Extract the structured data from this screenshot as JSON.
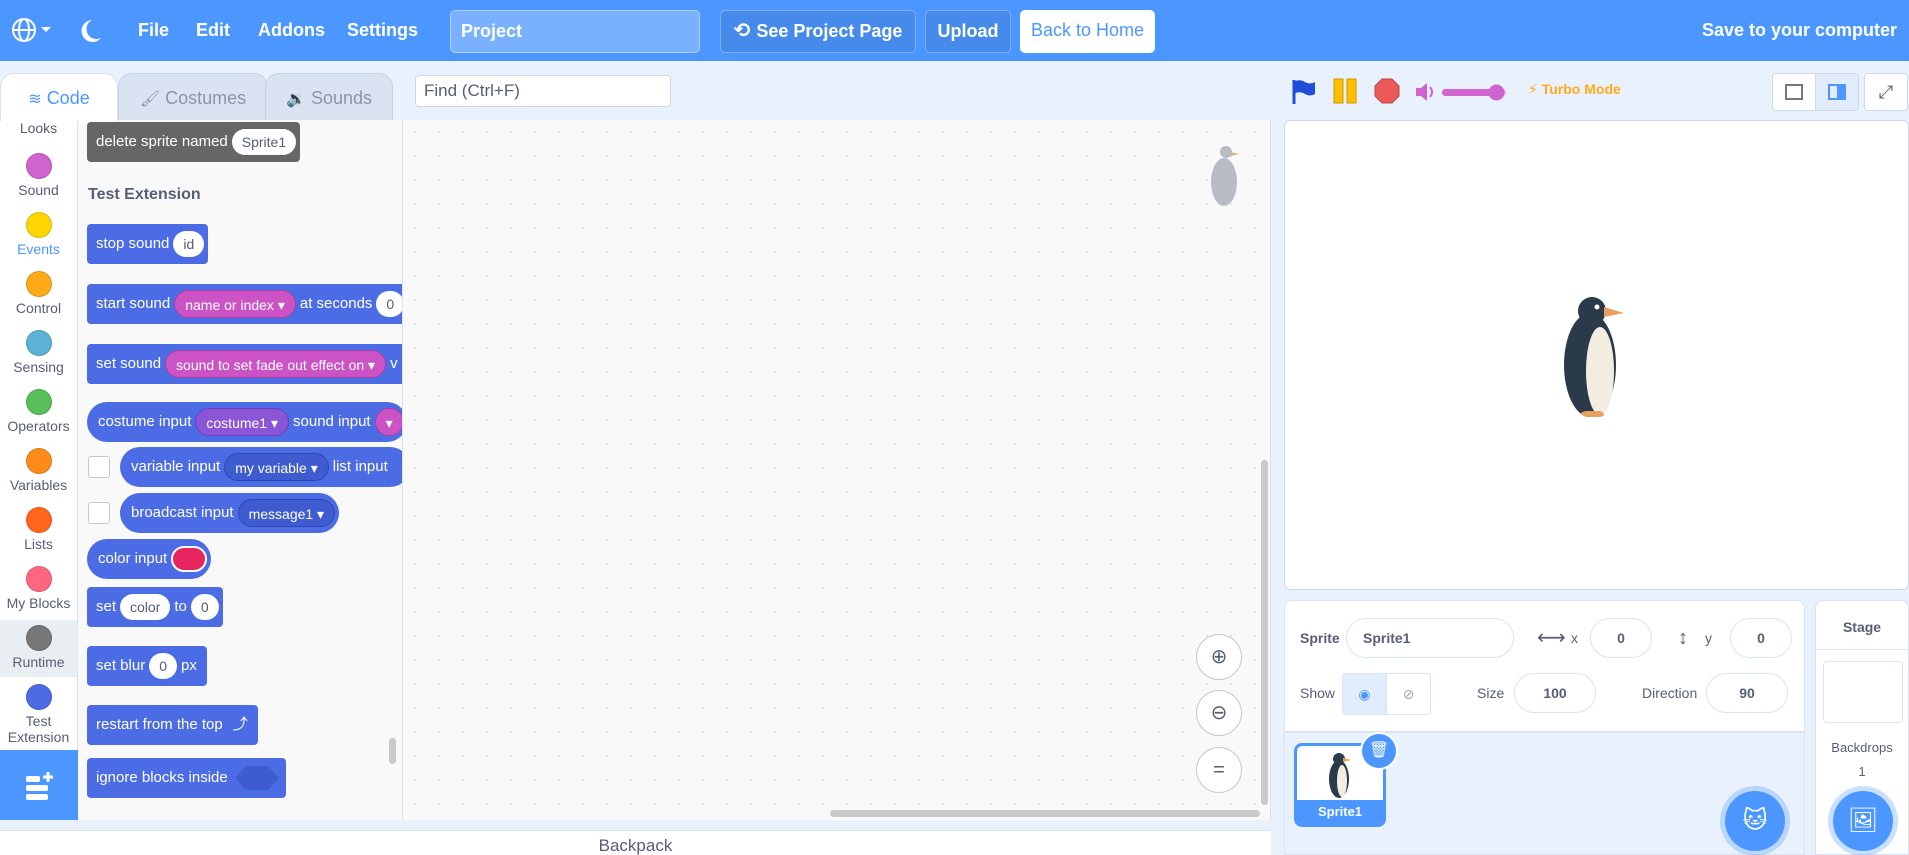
{
  "menubar": {
    "file": "File",
    "edit": "Edit",
    "addons": "Addons",
    "settings": "Settings",
    "project_title": "Project",
    "see_project_page": "See Project Page",
    "upload": "Upload",
    "back_to_home": "Back to Home",
    "save_to_computer": "Save to your computer"
  },
  "tabs": {
    "code": "Code",
    "costumes": "Costumes",
    "sounds": "Sounds"
  },
  "find": {
    "placeholder": "Find (Ctrl+F)"
  },
  "categories": [
    {
      "label": "Looks",
      "color": "#9966ff"
    },
    {
      "label": "Sound",
      "color": "#cf63cf"
    },
    {
      "label": "Events",
      "color": "#ffd500"
    },
    {
      "label": "Control",
      "color": "#ffab19"
    },
    {
      "label": "Sensing",
      "color": "#5cb1d6"
    },
    {
      "label": "Operators",
      "color": "#59c059"
    },
    {
      "label": "Variables",
      "color": "#ff8c1a"
    },
    {
      "label": "Lists",
      "color": "#ff661a"
    },
    {
      "label": "My Blocks",
      "color": "#ff6680"
    },
    {
      "label": "Runtime",
      "color": "#777777"
    },
    {
      "label": "Test Extension",
      "color": "#4c6ce6"
    }
  ],
  "palette": {
    "delete_sprite": {
      "text": "delete sprite named",
      "arg": "Sprite1"
    },
    "section_title": "Test Extension",
    "stop_sound": {
      "text": "stop sound",
      "arg": "id"
    },
    "start_sound": {
      "text": "start sound",
      "dropdown": "name or index",
      "text2": "at seconds",
      "arg": "0"
    },
    "set_sound": {
      "text": "set sound",
      "dropdown": "sound to set fade out effect on",
      "text2": "v"
    },
    "costume_input": {
      "text": "costume input",
      "dropdown": "costume1",
      "text2": "sound input"
    },
    "variable_input": {
      "text": "variable input",
      "dropdown": "my variable",
      "text2": "list input"
    },
    "broadcast_input": {
      "text": "broadcast input",
      "dropdown": "message1"
    },
    "color_input": {
      "text": "color input",
      "color": "#e6245e"
    },
    "set_color": {
      "text": "set",
      "arg1": "color",
      "text2": "to",
      "arg2": "0"
    },
    "set_blur": {
      "text": "set blur",
      "arg": "0",
      "text2": "px"
    },
    "restart": {
      "text": "restart from the top"
    },
    "ignore_blocks": {
      "text": "ignore blocks inside"
    }
  },
  "backpack": "Backpack",
  "stage_controls": {
    "turbo": "Turbo Mode",
    "volume": 0.85
  },
  "sprite_info": {
    "sprite_label": "Sprite",
    "sprite_name": "Sprite1",
    "x_label": "x",
    "x": "0",
    "y_label": "y",
    "y": "0",
    "show_label": "Show",
    "size_label": "Size",
    "size": "100",
    "direction_label": "Direction",
    "direction": "90"
  },
  "sprites": [
    {
      "name": "Sprite1",
      "selected": true
    }
  ],
  "stage_panel": {
    "title": "Stage",
    "backdrops_label": "Backdrops",
    "backdrops_count": "1"
  }
}
